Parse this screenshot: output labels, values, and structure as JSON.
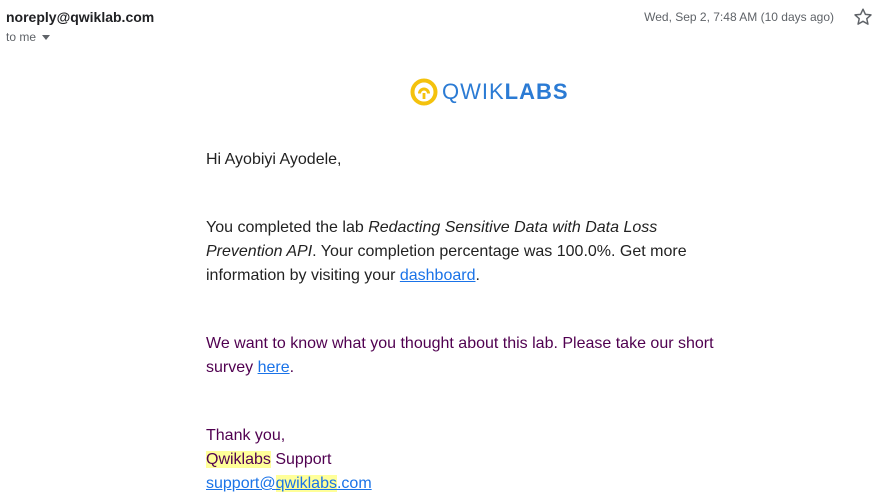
{
  "header": {
    "sender": "noreply@qwiklab.com",
    "recipient_label": "to me",
    "date": "Wed, Sep 2, 7:48 AM (10 days ago)"
  },
  "logo": {
    "text_light": "QWIK",
    "text_bold": "LABS",
    "brand_color": "#2b7bd4",
    "mark_color": "#f4c20d"
  },
  "body": {
    "greeting": "Hi Ayobiyi Ayodele,",
    "completion_prefix": "You completed the lab ",
    "lab_name": "Redacting Sensitive Data with Data Loss Prevention API",
    "completion_middle": ". Your completion percentage was 100.0%. Get more information by visiting your ",
    "dashboard_link": "dashboard",
    "completion_suffix": ".",
    "survey_prefix": "We want to know what you thought about this lab. Please take our short survey ",
    "survey_link": "here",
    "survey_suffix": ".",
    "thank_you": "Thank you,",
    "signature_brand": "Qwiklabs",
    "signature_team": " Support",
    "support_email_user": "support@",
    "support_email_brand": "qwiklabs",
    "support_email_tld": ".com"
  }
}
